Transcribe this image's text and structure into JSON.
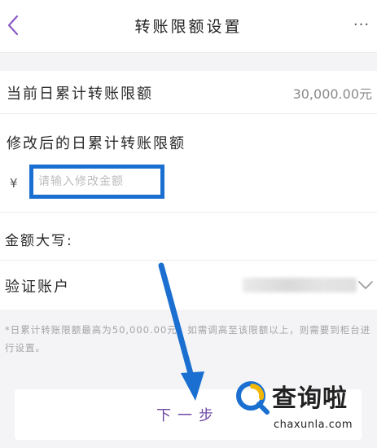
{
  "header": {
    "title": "转账限额设置",
    "back_icon": "chevron-left-icon",
    "more_label": "···",
    "accent_color": "#8a5bc5"
  },
  "current_limit": {
    "label": "当前日累计转账限额",
    "value": "30,000.00元"
  },
  "modify_limit": {
    "label": "修改后的日累计转账限额",
    "currency_symbol": "¥",
    "placeholder": "请输入修改金额",
    "value": ""
  },
  "amount_caps": {
    "label": "金额大写:"
  },
  "verify_account": {
    "label": "验证账户",
    "dropdown_icon": "chevron-down-icon"
  },
  "note": {
    "text": "*日累计转账限额最高为50,000.00元，如需调高至该限额以上，则需要到柜台进行设置。"
  },
  "next_button": {
    "label": "下一步"
  },
  "watermark": {
    "text": "查询啦",
    "domain": "chaxunla.com"
  },
  "annotation": {
    "highlight_color": "#1a6fd1"
  }
}
